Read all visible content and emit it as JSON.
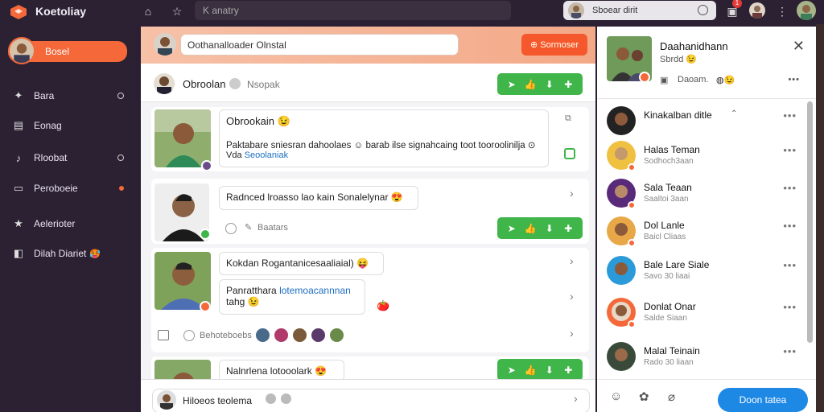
{
  "app": {
    "title": "Koetoliay",
    "search_placeholder": "K anatry",
    "profile_name": "Sboear dirit",
    "notif_count": "1"
  },
  "sidebar": {
    "active_label": "Bosel",
    "items": [
      {
        "label": "Bara",
        "icon": "puzzle-icon",
        "dot": "ring"
      },
      {
        "label": "Eonag",
        "icon": "inbox-icon",
        "dot": ""
      },
      {
        "label": "Rloobat",
        "icon": "audio-icon",
        "dot": "ring"
      },
      {
        "label": "Peroboeie",
        "icon": "card-icon",
        "dot": "orange"
      },
      {
        "label": "Aelerioter",
        "icon": "star-icon",
        "dot": ""
      },
      {
        "label": "Dilah Diariet",
        "icon": "bookmark-icon",
        "dot": "",
        "emoji": "🥵"
      }
    ]
  },
  "main": {
    "compose_placeholder": "Oothanalloader Olnstal",
    "compose_button": "Sormoser",
    "thread_title": "Obroolan",
    "thread_sub": "Nsopak",
    "cards": [
      {
        "title": "Obrookain 😉",
        "body": "Paktabare sniesran dahoolaes ☺ barab ilse signahcaing toot tooroolinilja ⊙",
        "link_prefix": "Vda",
        "link": "Seoolaniak"
      },
      {
        "bubble": "Radnced lroasso lao kain Sonalelynar 😍",
        "footer": "Baatars"
      },
      {
        "bubble1": "Kokdan Rogantanicesaaliaial) 😝",
        "bubble2_line1_prefix": "Panratthara",
        "bubble2_link": "lotemoacannnan",
        "bubble2_line2": "tahg 😉",
        "footer": "Behoteboebs"
      },
      {
        "bubble": "Nalnrlena lotooolark 😍"
      }
    ],
    "bottom_text": "Hiloeos teolema"
  },
  "right": {
    "name": "Daahanidhann",
    "meta": "Sbrdd 😉",
    "meta2": "Daoam.",
    "contacts": [
      {
        "name": "Kinakalban ditle",
        "status": "",
        "extra": "⌃"
      },
      {
        "name": "Halas Teman",
        "status": "Sodhoch3aan"
      },
      {
        "name": "Sala Teaan",
        "status": "Saaltoi 3aan"
      },
      {
        "name": "Dol Lanle",
        "status": "Baicl Cliaas"
      },
      {
        "name": "Bale Lare Siale",
        "status": "Savo 30 liaai"
      },
      {
        "name": "Donlat Onar",
        "status": "Salde Siaan"
      },
      {
        "name": "Malal Teinain",
        "status": "Rado 30 liaan"
      }
    ],
    "send_button": "Doon tatea"
  },
  "colors": {
    "accent": "#f5683a",
    "green": "#3fb54a",
    "blue": "#1e88e5",
    "sidebar_bg": "#2b2133"
  }
}
